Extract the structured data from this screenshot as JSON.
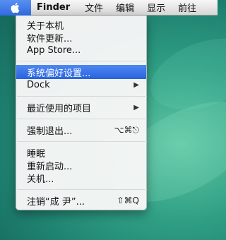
{
  "menubar": {
    "app_name": "Finder",
    "items": [
      "文件",
      "编辑",
      "显示",
      "前往"
    ]
  },
  "apple_menu": {
    "items": [
      {
        "label": "关于本机"
      },
      {
        "label": "软件更新..."
      },
      {
        "label": "App Store..."
      },
      {
        "label": "系统偏好设置..."
      },
      {
        "label": "Dock",
        "arrow": "▶"
      },
      {
        "label": "最近使用的项目",
        "arrow": "▶"
      },
      {
        "label": "强制退出...",
        "shortcut": "⌥⌘⎋"
      },
      {
        "label": "睡眠"
      },
      {
        "label": "重新启动..."
      },
      {
        "label": "关机..."
      },
      {
        "label": "注销“成 尹”...",
        "shortcut": "⇧⌘Q"
      }
    ],
    "highlighted_index": 3
  },
  "colors": {
    "highlight": "#2a62dd",
    "desktop": "#2f9f84"
  }
}
